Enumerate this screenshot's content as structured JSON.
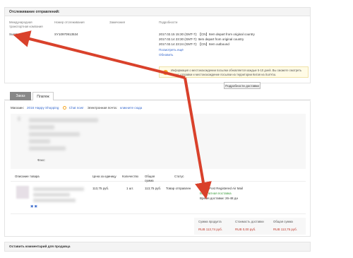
{
  "tracking": {
    "title": "Отслеживание отправлений:",
    "headers": [
      "Международная транспортная компания",
      "Номер отслеживания",
      "Замечания",
      "Подробности"
    ],
    "carrier": "SunYou",
    "tracking_number": "SY10970913534",
    "events": [
      "2017.02.15 15:30 (GMT-7): 【CN】Item depart from original country",
      "2017.02.14 23:30 (GMT-7): Item depart from original country",
      "2017.02.14 23:24 (GMT-7): 【CN】Item outbound"
    ],
    "show_more_label": "Посмотреть ещё",
    "refresh_label": "Обновить",
    "info_text": "Информация о местонахождении посылки обновляется каждые 5-10 дней. Вы сможете смотреть статус отправки и местонахождение посылки на территории Китая на SunYou.",
    "delivery_button_label": "Подробности доставки"
  },
  "tabs": {
    "order_label": "Заказ",
    "payment_label": "Платеж"
  },
  "order": {
    "store_label": "Магазин:",
    "store_name": "2016 Happy Shopping",
    "chat_label": "Chat now!",
    "email_label": "Электронная почта:",
    "email_link": "кликните сюда",
    "fax_label": "Факс:"
  },
  "items_table": {
    "headers": [
      "Описание товара",
      "Цена за единицу",
      "Количество",
      "Общая сумма",
      "Статус"
    ],
    "row": {
      "price": "113,75 руб.",
      "qty": "1 шт.",
      "total": "113,75 руб.",
      "status": "Товар отправлен"
    },
    "shipping_method": "China Post Registered Air Mail",
    "shipping_cost": "Бесплатная поставка",
    "delivery_time": "Время доставки: 26-48 дн"
  },
  "totals": {
    "product_label": "Сумма продукта",
    "shipping_label": "Стоимость доставки",
    "total_label": "Общая сумма",
    "product_value": "RUB 113,74 руб.",
    "shipping_value": "RUB 0,00 руб.",
    "total_value": "RUB 113,75 руб."
  },
  "comment": {
    "title": "Оставить комментарий для продавца"
  },
  "colors": {
    "link": "#3366cc",
    "arrow": "#d9412b",
    "price_red": "#c0392b",
    "green": "#3a9c3a"
  }
}
